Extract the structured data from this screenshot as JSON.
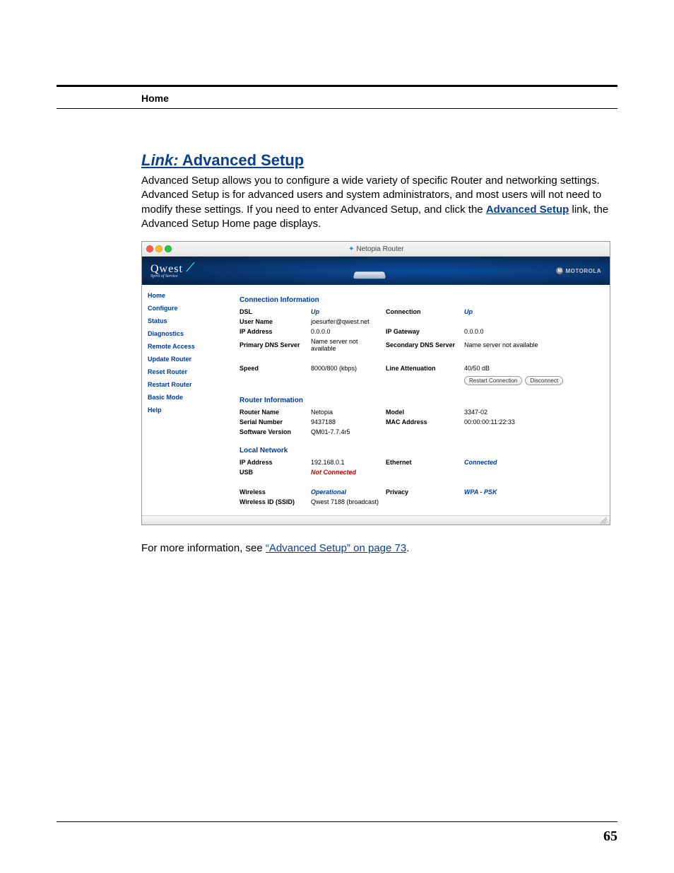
{
  "header": {
    "section": "Home"
  },
  "title": {
    "prefix": "Link:",
    "main": "Advanced Setup"
  },
  "para": {
    "t1": "Advanced Setup allows you to configure a wide variety of specific Router and networking settings. Advanced Setup is for advanced users and system administrators, and most users will not need to modify these settings. If you need to enter Advanced Setup, and click the ",
    "link": "Advanced Setup",
    "t2": " link, the Advanced Setup Home page displays."
  },
  "screenshot": {
    "window_title": "Netopia Router",
    "brand_left": "Qwest",
    "brand_left_sub": "Spirit of Service",
    "brand_right": "MOTOROLA",
    "nav": [
      "Home",
      "Configure",
      "Status",
      "Diagnostics",
      "Remote Access",
      "Update Router",
      "Reset Router",
      "Restart Router",
      "Basic Mode",
      "Help"
    ],
    "sec1_title": "Connection Information",
    "conn": {
      "dsl_l": "DSL",
      "dsl_v": "Up",
      "connection_l": "Connection",
      "connection_v": "Up",
      "user_l": "User Name",
      "user_v": "joesurfer@qwest.net",
      "ip_l": "IP Address",
      "ip_v": "0.0.0.0",
      "gw_l": "IP Gateway",
      "gw_v": "0.0.0.0",
      "pdns_l": "Primary DNS Server",
      "pdns_v": "Name server not available",
      "sdns_l": "Secondary DNS Server",
      "sdns_v": "Name server not available",
      "speed_l": "Speed",
      "speed_v": "8000/800 (kbps)",
      "att_l": "Line Attenuation",
      "att_v": "40/50 dB",
      "btn1": "Restart Connection",
      "btn2": "Disconnect"
    },
    "sec2_title": "Router Information",
    "router": {
      "name_l": "Router Name",
      "name_v": "Netopia",
      "model_l": "Model",
      "model_v": "3347-02",
      "serial_l": "Serial Number",
      "serial_v": "9437188",
      "mac_l": "MAC Address",
      "mac_v": "00:00:00:11:22:33",
      "soft_l": "Software Version",
      "soft_v": "QM01-7.7.4r5"
    },
    "sec3_title": "Local Network",
    "local": {
      "ip_l": "IP Address",
      "ip_v": "192.168.0.1",
      "eth_l": "Ethernet",
      "eth_v": "Connected",
      "usb_l": "USB",
      "usb_v": "Not Connected",
      "wl_l": "Wireless",
      "wl_v": "Operational",
      "priv_l": "Privacy",
      "priv_v": "WPA - PSK",
      "ssid_l": "Wireless ID (SSID)",
      "ssid_v": "Qwest 7188 (broadcast)"
    }
  },
  "after": {
    "t1": "For more information, see ",
    "xref": "“Advanced Setup” on page 73",
    "t2": "."
  },
  "page_number": "65"
}
